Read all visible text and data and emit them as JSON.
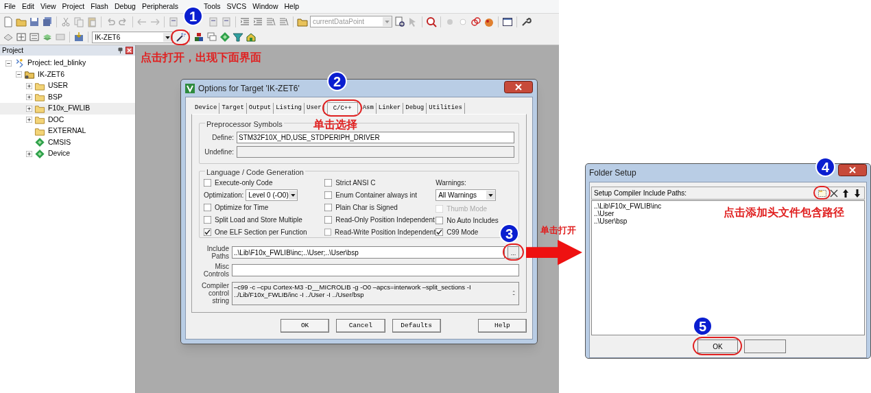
{
  "ide": {
    "menu_bar": [
      "File",
      "Edit",
      "View",
      "Project",
      "Flash",
      "Debug",
      "Peripherals",
      "Tools",
      "SVCS",
      "Window",
      "Help"
    ],
    "toolbar": {
      "data_point": {
        "value": "currentDataPoint",
        "disabled": true
      },
      "target": {
        "value": "IK-ZET6",
        "disabled": false
      }
    },
    "project_panel": {
      "title": "Project",
      "tree": [
        {
          "label": "Project: led_blinky",
          "kind": "project",
          "expanded": true,
          "selected": false,
          "children": [
            {
              "label": "IK-ZET6",
              "kind": "target",
              "expanded": true,
              "selected": false,
              "children": [
                {
                  "label": "USER",
                  "kind": "folder",
                  "expanded": false,
                  "selected": false
                },
                {
                  "label": "BSP",
                  "kind": "folder",
                  "expanded": false,
                  "selected": false
                },
                {
                  "label": "F10x_FWLIB",
                  "kind": "folder",
                  "expanded": false,
                  "selected": true
                },
                {
                  "label": "DOC",
                  "kind": "folder",
                  "expanded": false,
                  "selected": false
                },
                {
                  "label": "EXTERNAL",
                  "kind": "folder",
                  "selected": false
                },
                {
                  "label": "CMSIS",
                  "kind": "component",
                  "selected": false
                },
                {
                  "label": "Device",
                  "kind": "component",
                  "expanded": false,
                  "selected": false
                }
              ]
            }
          ]
        }
      ]
    }
  },
  "options_dialog": {
    "title": "Options for Target 'IK-ZET6'",
    "tabs": [
      {
        "label": "Device",
        "selected": false
      },
      {
        "label": "Target",
        "selected": false
      },
      {
        "label": "Output",
        "selected": false
      },
      {
        "label": "Listing",
        "selected": false
      },
      {
        "label": "User",
        "selected": false
      },
      {
        "label": "C/C++",
        "selected": true
      },
      {
        "label": "Asm",
        "selected": false
      },
      {
        "label": "Linker",
        "selected": false
      },
      {
        "label": "Debug",
        "selected": false
      },
      {
        "label": "Utilities",
        "selected": false
      }
    ],
    "preprocessor": {
      "title": "Preprocessor Symbols",
      "fields": [
        {
          "label": "Define:",
          "value": "STM32F10X_HD,USE_STDPERIPH_DRIVER"
        },
        {
          "label": "Undefine:"
        }
      ]
    },
    "code_generation": {
      "title": "Language / Code Generation",
      "columns": [
        [
          {
            "kind": "checkbox",
            "label": "Execute-only Code",
            "checked": false,
            "disabled": false
          },
          {
            "kind": "combo",
            "label": "Optimization:",
            "value": "Level 0 (-O0)"
          },
          {
            "kind": "checkbox",
            "label": "Optimize for Time",
            "checked": false,
            "disabled": false
          },
          {
            "kind": "checkbox",
            "label": "Split Load and Store Multiple",
            "checked": false,
            "disabled": false
          },
          {
            "kind": "checkbox",
            "label": "One ELF Section per Function",
            "checked": true,
            "disabled": false
          }
        ],
        [
          {
            "kind": "checkbox",
            "label": "Strict ANSI C",
            "checked": false,
            "disabled": false
          },
          {
            "kind": "checkbox",
            "label": "Enum Container always int",
            "checked": false,
            "disabled": false
          },
          {
            "kind": "checkbox",
            "label": "Plain Char is Signed",
            "checked": false,
            "disabled": false
          },
          {
            "kind": "checkbox",
            "label": "Read-Only Position Independent",
            "checked": false,
            "disabled": false
          },
          {
            "kind": "checkbox",
            "label": "Read-Write Position Independent",
            "checked": false,
            "disabled": false
          }
        ],
        [
          {
            "kind": "labeled_combo",
            "label": "Warnings:",
            "value": "All Warnings"
          },
          {
            "kind": "checkbox",
            "label": "Thumb Mode",
            "checked": false,
            "disabled": true
          },
          {
            "kind": "checkbox",
            "label": "No Auto Includes",
            "checked": false,
            "disabled": false
          },
          {
            "kind": "checkbox",
            "label": "C99 Mode",
            "checked": true,
            "disabled": false
          }
        ]
      ]
    },
    "include_paths": {
      "label_lines": [
        "Include",
        "Paths"
      ],
      "value": "..\\Lib\\F10x_FWLIB\\inc;..\\User;..\\User\\bsp",
      "browse": "..."
    },
    "misc_controls": {
      "label_lines": [
        "Misc",
        "Controls"
      ]
    },
    "compiler_string": {
      "label_lines": [
        "Compiler",
        "control",
        "string"
      ],
      "lines": [
        "–c99 -c –cpu Cortex-M3 -D__MICROLIB -g -O0 –apcs=interwork –split_sections -I",
        "../Lib/F10x_FWLIB/inc -I ../User -I ../User/bsp"
      ]
    },
    "buttons": [
      "OK",
      "Cancel",
      "Defaults",
      "Help"
    ]
  },
  "folder_setup": {
    "title": "Folder Setup",
    "label": "Setup Compiler Include Paths:",
    "paths": [
      "..\\Lib\\F10x_FWLIB\\inc",
      "..\\User",
      "..\\User\\bsp"
    ],
    "buttons": [
      "OK"
    ]
  },
  "annotations": {
    "steps": [
      "1",
      "2",
      "3",
      "4",
      "5"
    ],
    "notes": [
      "点击打开，出现下面界面",
      "单击选择",
      "单击打开",
      "点击添加头文件包含路径"
    ]
  }
}
